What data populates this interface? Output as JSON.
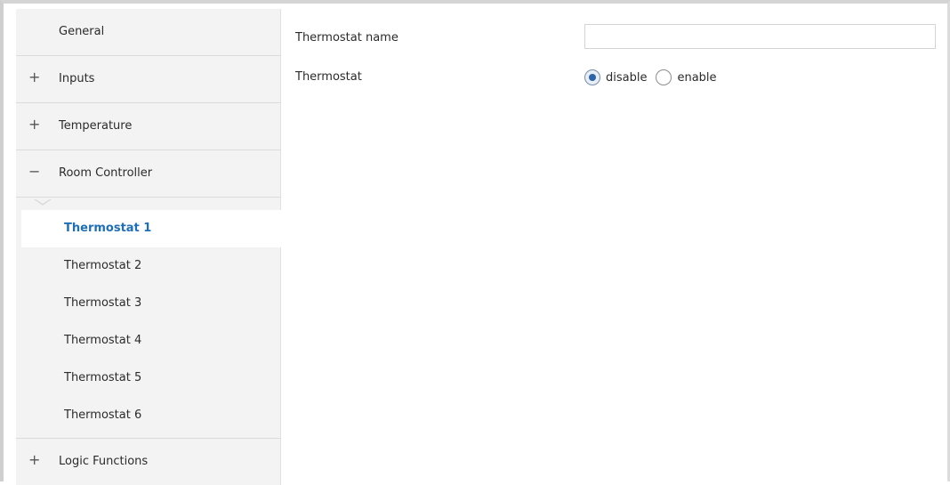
{
  "sidebar": {
    "items": [
      {
        "label": "General",
        "sign": ""
      },
      {
        "label": "Inputs",
        "sign": "+"
      },
      {
        "label": "Temperature",
        "sign": "+"
      },
      {
        "label": "Room Controller",
        "sign": "−"
      }
    ],
    "sub_items": [
      {
        "label": "Thermostat 1",
        "active": true
      },
      {
        "label": "Thermostat 2"
      },
      {
        "label": "Thermostat 3"
      },
      {
        "label": "Thermostat 4"
      },
      {
        "label": "Thermostat 5"
      },
      {
        "label": "Thermostat 6"
      }
    ],
    "bottom_item": {
      "label": "Logic Functions",
      "sign": "+"
    }
  },
  "content": {
    "thermostat_name_label": "Thermostat name",
    "thermostat_name_value": "",
    "thermostat_label": "Thermostat",
    "options": {
      "disable": "disable",
      "enable": "enable",
      "selected": "disable"
    }
  },
  "colors": {
    "active_text": "#1e6fb7",
    "sidebar_bg": "#f3f3f3",
    "radio_dot": "#2d63a7"
  }
}
